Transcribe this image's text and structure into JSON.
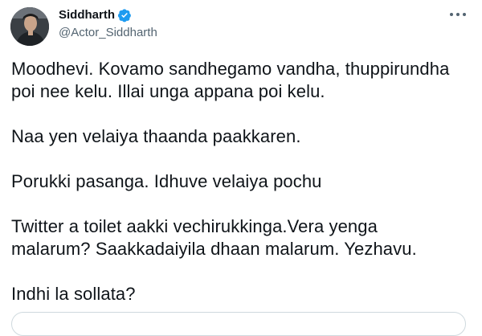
{
  "tweet": {
    "author": {
      "display_name": "Siddharth",
      "handle": "@Actor_Siddharth",
      "verified": true,
      "verified_icon": "verified-badge-icon",
      "verified_color": "#1d9bf0"
    },
    "more_icon": "more-options-icon",
    "text": {
      "p1_line1": "Moodhevi. Kovamo sandhegamo vandha, thuppirundha",
      "p1_line2": "poi nee kelu. Illai unga appana poi kelu.",
      "p2": "Naa yen velaiya thaanda paakkaren.",
      "p3": "Porukki pasanga. Idhuve velaiya pochu",
      "p4_line1": "Twitter a toilet aakki vechirukkinga.Vera yenga",
      "p4_line2": "malarum? Saakkadaiyila dhaan malarum. Yezhavu.",
      "p5": "Indhi la sollata?"
    }
  }
}
